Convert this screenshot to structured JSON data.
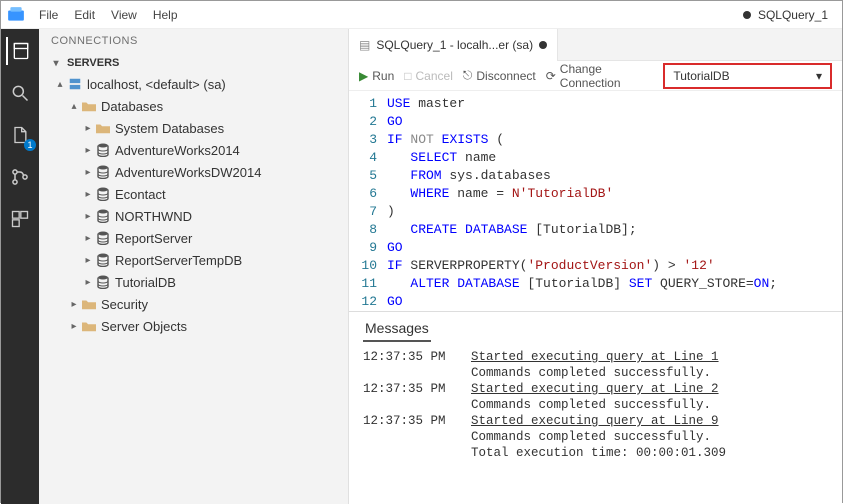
{
  "menu": {
    "items": [
      "File",
      "Edit",
      "View",
      "Help"
    ],
    "title_right": "SQLQuery_1"
  },
  "sidebar": {
    "title": "CONNECTIONS",
    "section": "SERVERS",
    "server_label": "localhost, <default> (sa)",
    "db_group": "Databases",
    "databases": [
      "System Databases",
      "AdventureWorks2014",
      "AdventureWorksDW2014",
      "Econtact",
      "NORTHWND",
      "ReportServer",
      "ReportServerTempDB",
      "TutorialDB"
    ],
    "security": "Security",
    "server_objects": "Server Objects"
  },
  "activity": {
    "badge": "1"
  },
  "tab": {
    "label": "SQLQuery_1 - localh...er (sa)"
  },
  "toolbar": {
    "run": "Run",
    "cancel": "Cancel",
    "disconnect": "Disconnect",
    "change": "Change Connection",
    "db_selected": "TutorialDB"
  },
  "code": {
    "lines": [
      {
        "n": 1,
        "html": "<span class='kw'>USE</span> master"
      },
      {
        "n": 2,
        "html": "<span class='kw'>GO</span>"
      },
      {
        "n": 3,
        "html": "<span class='kw'>IF</span> <span class='gray'>NOT</span> <span class='kw'>EXISTS</span> <span class='op'>(</span>"
      },
      {
        "n": 4,
        "html": "   <span class='kw'>SELECT</span> name"
      },
      {
        "n": 5,
        "html": "   <span class='kw'>FROM</span> sys.databases"
      },
      {
        "n": 6,
        "html": "   <span class='kw'>WHERE</span> name = <span class='str'>N'TutorialDB'</span>"
      },
      {
        "n": 7,
        "html": "<span class='op'>)</span>"
      },
      {
        "n": 8,
        "html": "   <span class='kw'>CREATE DATABASE</span> [TutorialDB];"
      },
      {
        "n": 9,
        "html": "<span class='kw'>GO</span>"
      },
      {
        "n": 10,
        "html": "<span class='kw'>IF</span> SERVERPROPERTY(<span class='str'>'ProductVersion'</span>) &gt; <span class='str'>'12'</span>"
      },
      {
        "n": 11,
        "html": "   <span class='kw'>ALTER DATABASE</span> [TutorialDB] <span class='kw'>SET</span> QUERY_STORE=<span class='kw'>ON</span>;"
      },
      {
        "n": 12,
        "html": "<span class='kw'>GO</span>"
      }
    ]
  },
  "messages": {
    "title": "Messages",
    "rows": [
      {
        "time": "12:37:35 PM",
        "text": "Started executing query at Line 1",
        "u": true
      },
      {
        "time": "",
        "text": "Commands completed successfully.",
        "u": false
      },
      {
        "time": "12:37:35 PM",
        "text": "Started executing query at Line 2",
        "u": true
      },
      {
        "time": "",
        "text": "Commands completed successfully.",
        "u": false
      },
      {
        "time": "12:37:35 PM",
        "text": "Started executing query at Line 9",
        "u": true
      },
      {
        "time": "",
        "text": "Commands completed successfully.",
        "u": false
      },
      {
        "time": "",
        "text": "Total execution time: 00:00:01.309",
        "u": false
      }
    ]
  }
}
